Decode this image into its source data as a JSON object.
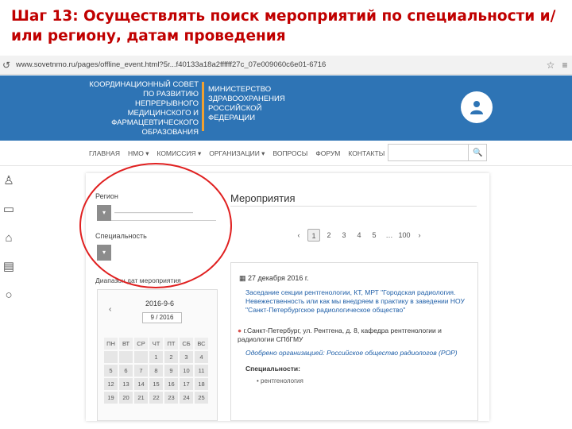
{
  "slide": {
    "title": "Шаг 13: Осуществлять поиск мероприятий по специальности и/или региону, датам проведения"
  },
  "browser": {
    "url_host": "www.sovetnmo.ru",
    "url_path": "/pages/offline_event.html?5r...f40133a18a2ffffff27c_07e009060c6e01-6716",
    "nav_icon": "back-arrow-icon",
    "tools": [
      "star-icon",
      "menu-icon"
    ]
  },
  "header": {
    "council_name": "Координационный совет по развитию непрерывного медицинского и фармацевтического образования",
    "ministry_name": "Министерство здравоохранения Российской Федерации",
    "colors": {
      "background": "#2e74b5",
      "divider": "#f0a030"
    }
  },
  "nav": {
    "items": [
      "Главная",
      "НМО ▾",
      "Комиссия ▾",
      "Организации ▾",
      "Вопросы",
      "Форум",
      "Контакты"
    ],
    "search_icon": "search-icon"
  },
  "side_tools": [
    "person-icon",
    "laptop-icon",
    "bank-icon",
    "certificate-icon",
    "chat-icon"
  ],
  "filters": {
    "region_label": "Регион",
    "region_value": "———————————",
    "specialty_label": "Специальность",
    "date_range_label": "Диапазон дат мероприятия"
  },
  "page_title": "Мероприятия",
  "pagination": [
    "‹",
    "1",
    "2",
    "3",
    "4",
    "5",
    "…",
    "100",
    "›"
  ],
  "pagination_active": "1",
  "calendar": {
    "selected_date": "2016-9-6",
    "prev": "‹",
    "month": "9 / 2016",
    "weekdays": [
      "ПН",
      "ВТ",
      "СР",
      "ЧТ",
      "ПТ",
      "СБ",
      "ВС"
    ],
    "weeks": [
      [
        "",
        "",
        "",
        "1",
        "2",
        "3",
        "4"
      ],
      [
        "5",
        "6",
        "7",
        "8",
        "9",
        "10",
        "11"
      ],
      [
        "12",
        "13",
        "14",
        "15",
        "16",
        "17",
        "18"
      ],
      [
        "19",
        "20",
        "21",
        "22",
        "23",
        "24",
        "25"
      ]
    ]
  },
  "event": {
    "date": "27 декабря 2016 г.",
    "title": "Заседание секции рентгенологии, КТ, МРТ \"Городская радиология. Невежественность или как мы внедряем в практику в заведении НОУ \"Санкт-Петербургское радиологическое общество\"",
    "place": "г.Санкт-Петербург, ул. Рентгена, д. 8, кафедра рентгенологии и радиологии СПбГМУ",
    "organizer": "Одобрено организацией: Российское общество радиологов (РОР)",
    "specialties_label": "Специальности:",
    "specialty": "рентгенология"
  },
  "annotation_color": "#e02020"
}
